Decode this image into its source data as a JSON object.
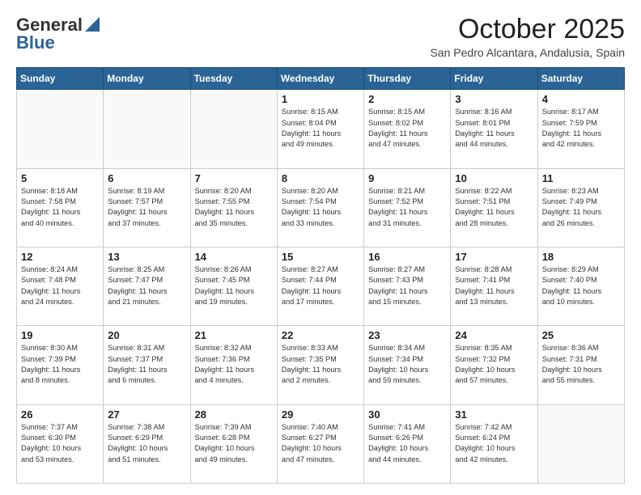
{
  "header": {
    "logo_general": "General",
    "logo_blue": "Blue",
    "month_title": "October 2025",
    "location": "San Pedro Alcantara, Andalusia, Spain"
  },
  "weekdays": [
    "Sunday",
    "Monday",
    "Tuesday",
    "Wednesday",
    "Thursday",
    "Friday",
    "Saturday"
  ],
  "weeks": [
    [
      {
        "day": "",
        "info": ""
      },
      {
        "day": "",
        "info": ""
      },
      {
        "day": "",
        "info": ""
      },
      {
        "day": "1",
        "info": "Sunrise: 8:15 AM\nSunset: 8:04 PM\nDaylight: 11 hours\nand 49 minutes."
      },
      {
        "day": "2",
        "info": "Sunrise: 8:15 AM\nSunset: 8:02 PM\nDaylight: 11 hours\nand 47 minutes."
      },
      {
        "day": "3",
        "info": "Sunrise: 8:16 AM\nSunset: 8:01 PM\nDaylight: 11 hours\nand 44 minutes."
      },
      {
        "day": "4",
        "info": "Sunrise: 8:17 AM\nSunset: 7:59 PM\nDaylight: 11 hours\nand 42 minutes."
      }
    ],
    [
      {
        "day": "5",
        "info": "Sunrise: 8:18 AM\nSunset: 7:58 PM\nDaylight: 11 hours\nand 40 minutes."
      },
      {
        "day": "6",
        "info": "Sunrise: 8:19 AM\nSunset: 7:57 PM\nDaylight: 11 hours\nand 37 minutes."
      },
      {
        "day": "7",
        "info": "Sunrise: 8:20 AM\nSunset: 7:55 PM\nDaylight: 11 hours\nand 35 minutes."
      },
      {
        "day": "8",
        "info": "Sunrise: 8:20 AM\nSunset: 7:54 PM\nDaylight: 11 hours\nand 33 minutes."
      },
      {
        "day": "9",
        "info": "Sunrise: 8:21 AM\nSunset: 7:52 PM\nDaylight: 11 hours\nand 31 minutes."
      },
      {
        "day": "10",
        "info": "Sunrise: 8:22 AM\nSunset: 7:51 PM\nDaylight: 11 hours\nand 28 minutes."
      },
      {
        "day": "11",
        "info": "Sunrise: 8:23 AM\nSunset: 7:49 PM\nDaylight: 11 hours\nand 26 minutes."
      }
    ],
    [
      {
        "day": "12",
        "info": "Sunrise: 8:24 AM\nSunset: 7:48 PM\nDaylight: 11 hours\nand 24 minutes."
      },
      {
        "day": "13",
        "info": "Sunrise: 8:25 AM\nSunset: 7:47 PM\nDaylight: 11 hours\nand 21 minutes."
      },
      {
        "day": "14",
        "info": "Sunrise: 8:26 AM\nSunset: 7:45 PM\nDaylight: 11 hours\nand 19 minutes."
      },
      {
        "day": "15",
        "info": "Sunrise: 8:27 AM\nSunset: 7:44 PM\nDaylight: 11 hours\nand 17 minutes."
      },
      {
        "day": "16",
        "info": "Sunrise: 8:27 AM\nSunset: 7:43 PM\nDaylight: 11 hours\nand 15 minutes."
      },
      {
        "day": "17",
        "info": "Sunrise: 8:28 AM\nSunset: 7:41 PM\nDaylight: 11 hours\nand 13 minutes."
      },
      {
        "day": "18",
        "info": "Sunrise: 8:29 AM\nSunset: 7:40 PM\nDaylight: 11 hours\nand 10 minutes."
      }
    ],
    [
      {
        "day": "19",
        "info": "Sunrise: 8:30 AM\nSunset: 7:39 PM\nDaylight: 11 hours\nand 8 minutes."
      },
      {
        "day": "20",
        "info": "Sunrise: 8:31 AM\nSunset: 7:37 PM\nDaylight: 11 hours\nand 6 minutes."
      },
      {
        "day": "21",
        "info": "Sunrise: 8:32 AM\nSunset: 7:36 PM\nDaylight: 11 hours\nand 4 minutes."
      },
      {
        "day": "22",
        "info": "Sunrise: 8:33 AM\nSunset: 7:35 PM\nDaylight: 11 hours\nand 2 minutes."
      },
      {
        "day": "23",
        "info": "Sunrise: 8:34 AM\nSunset: 7:34 PM\nDaylight: 10 hours\nand 59 minutes."
      },
      {
        "day": "24",
        "info": "Sunrise: 8:35 AM\nSunset: 7:32 PM\nDaylight: 10 hours\nand 57 minutes."
      },
      {
        "day": "25",
        "info": "Sunrise: 8:36 AM\nSunset: 7:31 PM\nDaylight: 10 hours\nand 55 minutes."
      }
    ],
    [
      {
        "day": "26",
        "info": "Sunrise: 7:37 AM\nSunset: 6:30 PM\nDaylight: 10 hours\nand 53 minutes."
      },
      {
        "day": "27",
        "info": "Sunrise: 7:38 AM\nSunset: 6:29 PM\nDaylight: 10 hours\nand 51 minutes."
      },
      {
        "day": "28",
        "info": "Sunrise: 7:39 AM\nSunset: 6:28 PM\nDaylight: 10 hours\nand 49 minutes."
      },
      {
        "day": "29",
        "info": "Sunrise: 7:40 AM\nSunset: 6:27 PM\nDaylight: 10 hours\nand 47 minutes."
      },
      {
        "day": "30",
        "info": "Sunrise: 7:41 AM\nSunset: 6:26 PM\nDaylight: 10 hours\nand 44 minutes."
      },
      {
        "day": "31",
        "info": "Sunrise: 7:42 AM\nSunset: 6:24 PM\nDaylight: 10 hours\nand 42 minutes."
      },
      {
        "day": "",
        "info": ""
      }
    ]
  ]
}
